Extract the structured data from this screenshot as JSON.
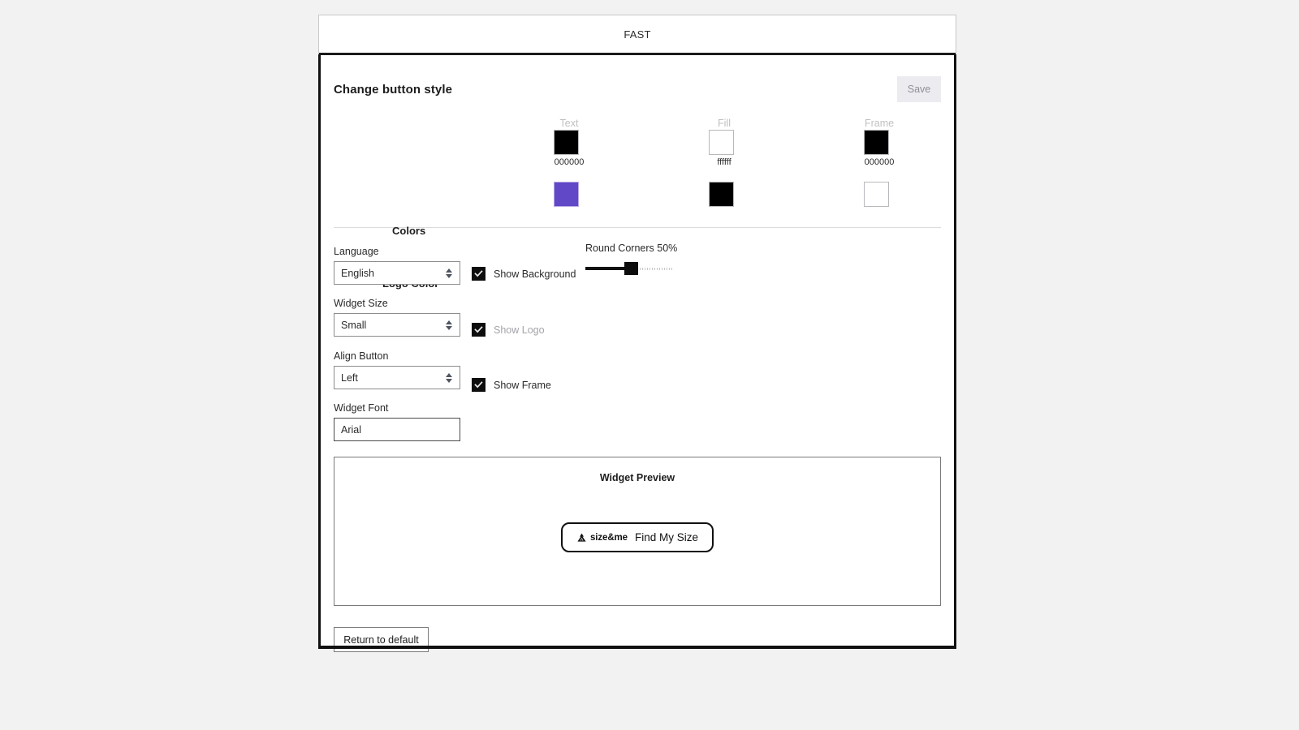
{
  "window": {
    "tab_label": "FAST"
  },
  "panel": {
    "title": "Change button style",
    "save_label": "Save"
  },
  "colors_section": {
    "column_headers": [
      "Text",
      "Fill",
      "Frame"
    ],
    "rows": [
      {
        "label": "Colors",
        "swatches": [
          {
            "color": "#000000",
            "hex_label": "000000"
          },
          {
            "color": "#ffffff",
            "hex_label": "ffffff"
          },
          {
            "color": "#000000",
            "hex_label": "000000"
          }
        ]
      },
      {
        "label": "Logo Color",
        "swatches": [
          {
            "color": "#6048c6",
            "hex_label": ""
          },
          {
            "color": "#000000",
            "hex_label": ""
          },
          {
            "color": "#ffffff",
            "hex_label": ""
          }
        ]
      }
    ]
  },
  "form": {
    "language": {
      "label": "Language",
      "value": "English"
    },
    "widget_size": {
      "label": "Widget Size",
      "value": "Small"
    },
    "align_button": {
      "label": "Align Button",
      "value": "Left"
    },
    "widget_font": {
      "label": "Widget Font",
      "value": "Arial",
      "placeholder": "Arial"
    },
    "checkboxes": [
      {
        "label": "Show Background",
        "checked": true,
        "dimmed": false
      },
      {
        "label": "Show Logo",
        "checked": true,
        "dimmed": true
      },
      {
        "label": "Show Frame",
        "checked": true,
        "dimmed": false
      }
    ],
    "slider": {
      "label": "Round Corners 50%",
      "name": "Round Corners",
      "value": 50,
      "unit": "%",
      "min": 0,
      "max": 100
    }
  },
  "preview": {
    "title": "Widget Preview",
    "brand_name": "size&me",
    "cta_label": "Find My Size"
  },
  "footer": {
    "return_label": "Return to default"
  }
}
